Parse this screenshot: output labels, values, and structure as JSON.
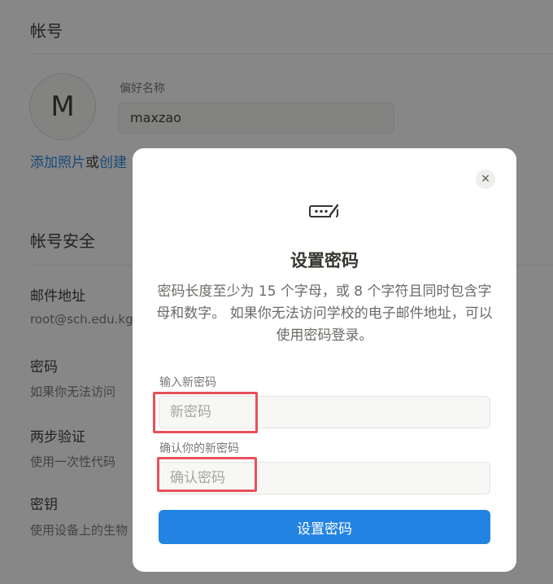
{
  "account": {
    "section_title": "帐号",
    "avatar_initial": "M",
    "preferred_name_label": "偏好名称",
    "preferred_name_value": "maxzao",
    "add_photo_link": "添加照片",
    "or_text": "或",
    "create_link": "创建"
  },
  "security": {
    "section_title": "帐号安全",
    "email_title": "邮件地址",
    "email_value": "root@sch.edu.kg",
    "password_title": "密码",
    "password_desc": "如果你无法访问",
    "two_step_title": "两步验证",
    "two_step_desc": "使用一次性代码",
    "passkey_title": "密钥",
    "passkey_desc": "使用设备上的生物"
  },
  "modal": {
    "icon": "password-icon",
    "title": "设置密码",
    "description": "密码长度至少为 15 个字母，或 8 个字符且同时包含字母和数字。 如果你无法访问学校的电子邮件地址，可以使用密码登录。",
    "new_password_label": "输入新密码",
    "new_password_placeholder": "新密码",
    "new_password_value": "",
    "confirm_password_label": "确认你的新密码",
    "confirm_password_placeholder": "确认密码",
    "confirm_password_value": "",
    "submit_label": "设置密码",
    "close_icon": "close-icon"
  },
  "colors": {
    "accent": "#2383e2",
    "highlight": "#e8505b",
    "overlay": "rgba(15,15,15,0.5)"
  }
}
